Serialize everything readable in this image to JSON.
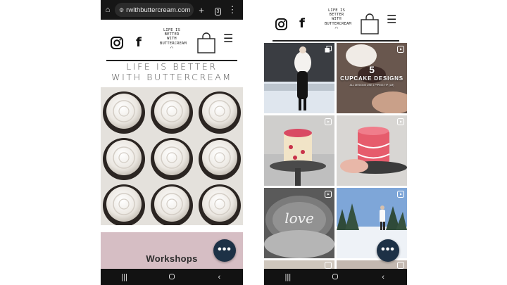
{
  "left_phone": {
    "browser": {
      "url": "rwithbuttercream.com",
      "tab_count": "3",
      "home_icon": "home-icon",
      "tune_icon": "tune-icon",
      "new_tab_icon": "plus-icon",
      "menu_icon": "more-vert-icon"
    },
    "header": {
      "instagram_icon": "instagram-icon",
      "facebook_icon": "facebook-icon",
      "logo_lines": [
        "LIFE IS",
        "BETTER WITH",
        "BUTTERCREAM"
      ],
      "bag_icon": "shopping-bag-icon",
      "menu_icon": "hamburger-icon"
    },
    "banner": {
      "line1": "LIFE IS BETTER",
      "line2": "WITH BUTTERCREAM"
    },
    "hero_image": "cupcakes-photo",
    "workshops": {
      "title": "Workshops",
      "background": "#d6bec4"
    },
    "fab_label": "•••"
  },
  "right_phone": {
    "header": {
      "instagram_icon": "instagram-icon",
      "facebook_icon": "facebook-icon",
      "logo_lines": [
        "LIFE IS",
        "BETTER WITH",
        "BUTTERCREAM"
      ],
      "bag_icon": "shopping-bag-icon",
      "menu_icon": "hamburger-icon"
    },
    "tiles": [
      {
        "name": "woman-in-snow-photo",
        "badge": "carousel-icon"
      },
      {
        "name": "cupcake-designs-tile",
        "badge": "reel-icon",
        "big": "5",
        "title": "CUPCAKE DESIGNS",
        "sub": "ALL DESIGNS USE 1 PIPING TIP (1M)"
      },
      {
        "name": "heart-cake-photo",
        "badge": "reel-icon"
      },
      {
        "name": "pink-vintage-cake-photo",
        "badge": "reel-icon"
      },
      {
        "name": "love-cake-photo",
        "badge": "reel-icon"
      },
      {
        "name": "snowy-forest-photo",
        "badge": "reel-icon"
      }
    ],
    "fab_label": "•••"
  },
  "nav": {
    "recents": "|||",
    "home": "home-icon",
    "back": "‹"
  },
  "colors": {
    "fab": "#1d3146",
    "browser_bar": "#161616",
    "nav_bar": "#121212"
  }
}
